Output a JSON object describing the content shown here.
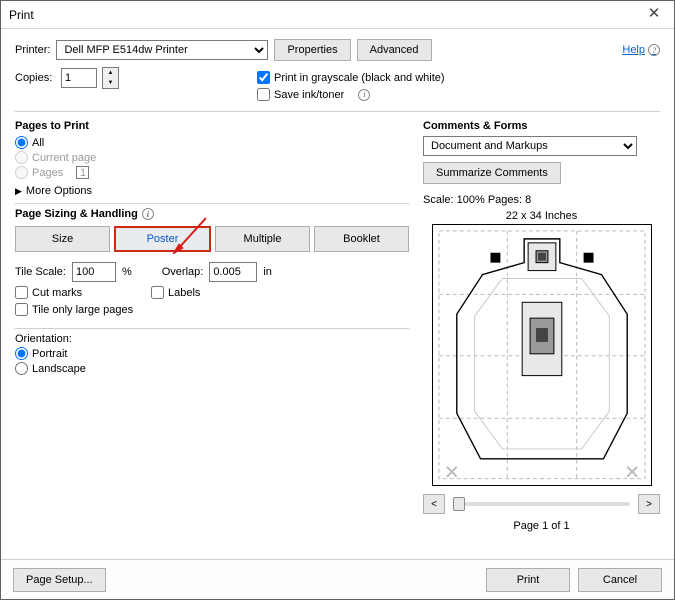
{
  "window": {
    "title": "Print"
  },
  "header": {
    "printer_label": "Printer:",
    "printer_value": "Dell MFP E514dw Printer",
    "properties_btn": "Properties",
    "advanced_btn": "Advanced",
    "help_link": "Help",
    "copies_label": "Copies:",
    "copies_value": "1",
    "grayscale_label": "Print in grayscale (black and white)",
    "saveink_label": "Save ink/toner"
  },
  "pages": {
    "heading": "Pages to Print",
    "all": "All",
    "current": "Current page",
    "pages_label": "Pages",
    "pages_value": "1",
    "more": "More Options"
  },
  "sizing": {
    "heading": "Page Sizing & Handling",
    "size": "Size",
    "poster": "Poster",
    "multiple": "Multiple",
    "booklet": "Booklet",
    "tile_scale_label": "Tile Scale:",
    "tile_scale_value": "100",
    "percent": "%",
    "overlap_label": "Overlap:",
    "overlap_value": "0.005",
    "overlap_unit": "in",
    "cut_marks": "Cut marks",
    "labels": "Labels",
    "tile_large": "Tile only large pages"
  },
  "orientation": {
    "heading": "Orientation:",
    "portrait": "Portrait",
    "landscape": "Landscape"
  },
  "right": {
    "heading": "Comments & Forms",
    "combo_value": "Document and Markups",
    "summarize": "Summarize Comments",
    "scale_line": "Scale: 100% Pages: 8",
    "dimensions": "22 x 34 Inches",
    "page_of": "Page 1 of 1",
    "prev": "<",
    "next": ">"
  },
  "footer": {
    "page_setup": "Page Setup...",
    "print": "Print",
    "cancel": "Cancel"
  }
}
